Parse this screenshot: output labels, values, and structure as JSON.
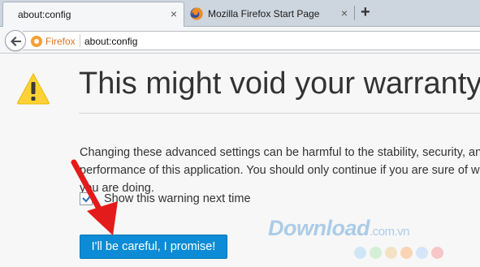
{
  "tabs": [
    {
      "label": "about:config",
      "close": "×",
      "active": true
    },
    {
      "label": "Mozilla Firefox Start Page",
      "close": "×",
      "active": false
    }
  ],
  "new_tab": "+",
  "urlbar": {
    "identity_label": "Firefox",
    "url": "about:config"
  },
  "page": {
    "title": "This might void your warranty!",
    "description": "Changing these advanced settings can be harmful to the stability, security, and performance of this application. You should only continue if you are sure of what you are doing.",
    "checkbox_label": "Show this warning next time",
    "checkbox_checked": true,
    "button_label": "I'll be careful, I promise!"
  },
  "watermark": {
    "brand": "Download",
    "suffix": ".com.vn"
  },
  "colors": {
    "accent_button": "#0c8cd6",
    "warning_yellow": "#fed234",
    "annotation_arrow": "#e41b1b",
    "watermark_dots": [
      "#cfe6f7",
      "#d4efd6",
      "#f3e3c4",
      "#f9d3b4",
      "#d6e6f8",
      "#f7c6c6"
    ]
  }
}
